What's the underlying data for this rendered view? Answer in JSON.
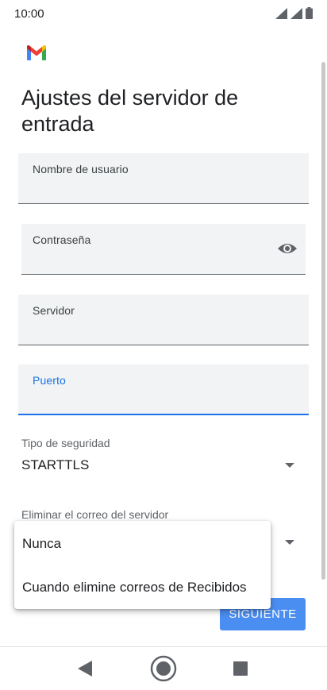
{
  "status_bar": {
    "time": "10:00",
    "icons": [
      "signal-icon",
      "signal-icon",
      "battery-icon"
    ]
  },
  "app": {
    "logo": "gmail-logo"
  },
  "page": {
    "title": "Ajustes del servidor de entrada"
  },
  "form": {
    "username": {
      "label": "Nombre de usuario",
      "value": ""
    },
    "password": {
      "label": "Contraseña",
      "value": "",
      "icon": "eye-icon"
    },
    "server": {
      "label": "Servidor",
      "value": ""
    },
    "port": {
      "label": "Puerto",
      "value": "",
      "focused": true
    },
    "security": {
      "label": "Tipo de seguridad",
      "value": "STARTTLS"
    },
    "delete_from_server": {
      "label": "Eliminar el correo del servidor",
      "value": ""
    }
  },
  "menu": {
    "items": [
      {
        "label": "Nunca"
      },
      {
        "label": "Cuando elimine correos de Recibidos"
      }
    ]
  },
  "buttons": {
    "next": "SIGUIENTE"
  },
  "nav": {
    "back": "back-icon",
    "home": "home-icon",
    "recents": "recents-icon"
  },
  "colors": {
    "accent": "#1a73e8",
    "button": "#4a8ef2",
    "field_bg": "#f1f3f4"
  }
}
